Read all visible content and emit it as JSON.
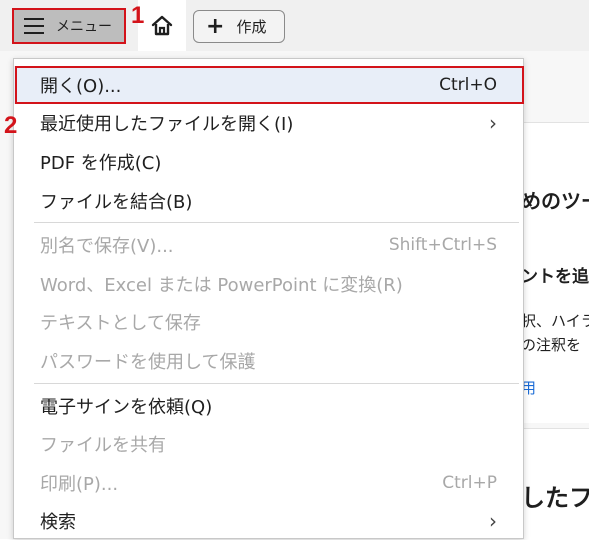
{
  "toolbar": {
    "menu_label": "メニュー",
    "create_label": "作成"
  },
  "annotations": {
    "step1": "1",
    "step2": "2"
  },
  "background": {
    "line1": "めのツー",
    "line2": "ントを追",
    "line3": "択、ハイラ",
    "line4": "の注釈を",
    "line5": "用",
    "line6": "したフ"
  },
  "menu": {
    "items": [
      {
        "label": "開く(O)...",
        "shortcut": "Ctrl+O",
        "enabled": true
      },
      {
        "label": "最近使用したファイルを開く(I)",
        "submenu": true,
        "enabled": true
      },
      {
        "label": "PDF を作成(C)",
        "enabled": true
      },
      {
        "label": "ファイルを結合(B)",
        "enabled": true
      },
      {
        "label": "別名で保存(V)...",
        "shortcut": "Shift+Ctrl+S",
        "enabled": false
      },
      {
        "label": "Word、Excel または PowerPoint に変換(R)",
        "enabled": false
      },
      {
        "label": "テキストとして保存",
        "enabled": false
      },
      {
        "label": "パスワードを使用して保護",
        "enabled": false
      },
      {
        "label": "電子サインを依頼(Q)",
        "enabled": true
      },
      {
        "label": "ファイルを共有",
        "enabled": false
      },
      {
        "label": "印刷(P)...",
        "shortcut": "Ctrl+P",
        "enabled": false
      },
      {
        "label": "検索",
        "submenu": true,
        "enabled": true
      }
    ]
  },
  "colors": {
    "annotation_red": "#d3131a",
    "disabled_text": "#a8a8a8",
    "hover_bg": "#e8eef8"
  }
}
